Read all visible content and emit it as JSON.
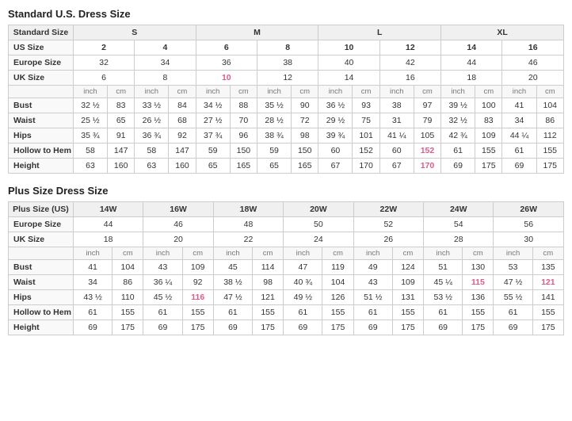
{
  "standard": {
    "title": "Standard U.S. Dress Size",
    "size_groups": [
      "S",
      "M",
      "L",
      "XL"
    ],
    "us_sizes": [
      "2",
      "4",
      "6",
      "8",
      "10",
      "12",
      "14",
      "16"
    ],
    "europe_sizes": [
      "32",
      "34",
      "36",
      "38",
      "40",
      "42",
      "44",
      "46"
    ],
    "uk_sizes": [
      "6",
      "8",
      "10",
      "12",
      "14",
      "16",
      "18",
      "20"
    ],
    "uk_highlight": [
      2,
      3
    ],
    "rows": {
      "Bust": [
        [
          "32 ½",
          "83"
        ],
        [
          "33 ½",
          "84"
        ],
        [
          "34 ½",
          "88"
        ],
        [
          "35 ½",
          "90"
        ],
        [
          "36 ½",
          "93"
        ],
        [
          "38",
          "97"
        ],
        [
          "39 ½",
          "100"
        ],
        [
          "41",
          "104"
        ]
      ],
      "Waist": [
        [
          "25 ½",
          "65"
        ],
        [
          "26 ½",
          "68"
        ],
        [
          "27 ½",
          "70"
        ],
        [
          "28 ½",
          "72"
        ],
        [
          "29 ½",
          "75"
        ],
        [
          "31",
          "79"
        ],
        [
          "32 ½",
          "83"
        ],
        [
          "34",
          "86"
        ]
      ],
      "Hips": [
        [
          "35 ¾",
          "91"
        ],
        [
          "36 ¾",
          "92"
        ],
        [
          "37 ¾",
          "96"
        ],
        [
          "38 ¾",
          "98"
        ],
        [
          "39 ¾",
          "101"
        ],
        [
          "41 ¼",
          "105"
        ],
        [
          "42 ¾",
          "109"
        ],
        [
          "44 ¼",
          "112"
        ]
      ],
      "Hollow to Hem": [
        [
          "58",
          "147"
        ],
        [
          "58",
          "147"
        ],
        [
          "59",
          "150"
        ],
        [
          "59",
          "150"
        ],
        [
          "60",
          "152"
        ],
        [
          "60",
          "152"
        ],
        [
          "61",
          "155"
        ],
        [
          "61",
          "155"
        ]
      ],
      "Height": [
        [
          "63",
          "160"
        ],
        [
          "63",
          "160"
        ],
        [
          "65",
          "165"
        ],
        [
          "65",
          "165"
        ],
        [
          "67",
          "170"
        ],
        [
          "67",
          "170"
        ],
        [
          "69",
          "175"
        ],
        [
          "69",
          "175"
        ]
      ]
    },
    "hollow_highlight": [
      5,
      7
    ],
    "height_highlight": [
      5,
      7
    ]
  },
  "plus": {
    "title": "Plus Size Dress Size",
    "size_groups": [
      "14W",
      "16W",
      "18W",
      "20W",
      "22W",
      "24W",
      "26W"
    ],
    "europe_sizes": [
      "44",
      "46",
      "48",
      "50",
      "52",
      "54",
      "56"
    ],
    "uk_sizes": [
      "18",
      "20",
      "22",
      "24",
      "26",
      "28",
      "30"
    ],
    "rows": {
      "Bust": [
        [
          "41",
          "104"
        ],
        [
          "43",
          "109"
        ],
        [
          "45",
          "114"
        ],
        [
          "47",
          "119"
        ],
        [
          "49",
          "124"
        ],
        [
          "51",
          "130"
        ],
        [
          "53",
          "135"
        ]
      ],
      "Waist": [
        [
          "34",
          "86"
        ],
        [
          "36 ¼",
          "92"
        ],
        [
          "38 ½",
          "98"
        ],
        [
          "40 ¾",
          "104"
        ],
        [
          "43",
          "109"
        ],
        [
          "45 ¼",
          "115"
        ],
        [
          "47 ½",
          "121"
        ]
      ],
      "Hips": [
        [
          "43 ½",
          "110"
        ],
        [
          "45 ½",
          "116"
        ],
        [
          "47 ½",
          "121"
        ],
        [
          "49 ½",
          "126"
        ],
        [
          "51 ½",
          "131"
        ],
        [
          "53 ½",
          "136"
        ],
        [
          "55 ½",
          "141"
        ]
      ],
      "Hollow to Hem": [
        [
          "61",
          "155"
        ],
        [
          "61",
          "155"
        ],
        [
          "61",
          "155"
        ],
        [
          "61",
          "155"
        ],
        [
          "61",
          "155"
        ],
        [
          "61",
          "155"
        ],
        [
          "61",
          "155"
        ]
      ],
      "Height": [
        [
          "69",
          "175"
        ],
        [
          "69",
          "175"
        ],
        [
          "69",
          "175"
        ],
        [
          "69",
          "175"
        ],
        [
          "69",
          "175"
        ],
        [
          "69",
          "175"
        ],
        [
          "69",
          "175"
        ]
      ]
    },
    "waist_highlight": [
      3,
      5
    ],
    "hips_highlight": [
      1,
      5
    ]
  }
}
